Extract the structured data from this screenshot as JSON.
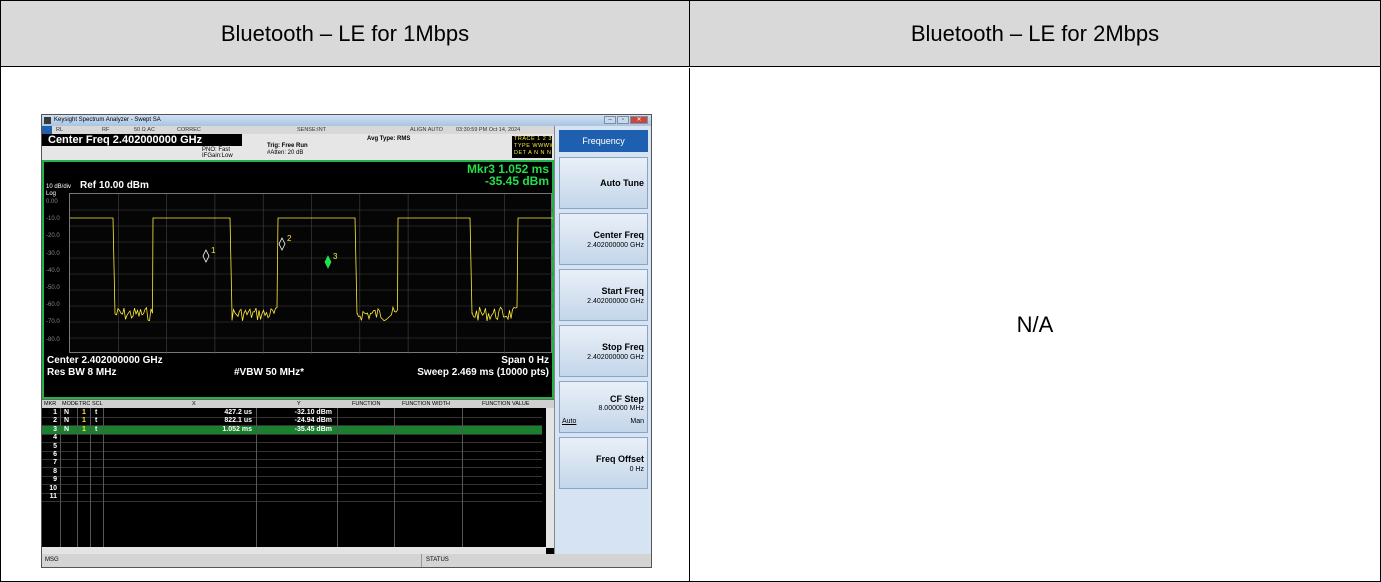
{
  "table": {
    "col1_header": "Bluetooth – LE for 1Mbps",
    "col2_header": "Bluetooth – LE for 2Mbps",
    "col2_value": "N/A"
  },
  "analyzer": {
    "window_title": "Keysight Spectrum Analyzer - Swept SA",
    "status_bar": {
      "rl": "RL",
      "rf": "RF",
      "impedance": "50 Ω AC",
      "correc": "CORREC",
      "sense": "SENSE:INT",
      "align": "ALIGN AUTO",
      "datetime": "03:30:59 PM Oct 14, 2024"
    },
    "center_freq_title": "Center Freq 2.402000000 GHz",
    "pno": "PNO: Fast",
    "ifgain": "IFGain:Low",
    "trig": "Trig: Free Run",
    "atten": "#Atten: 20 dB",
    "avg_type": "Avg Type: RMS",
    "trace_line1": "TRACE 1 2 3 4 5 6",
    "trace_line2": "TYPE WWWWWW",
    "trace_line3": "DET A N N N N N",
    "scale": "10 dB/div",
    "log_label": "Log",
    "ref_level": "Ref 10.00 dBm",
    "marker_readout_time": "Mkr3 1.052 ms",
    "marker_readout_level": "-35.45 dBm",
    "y_ticks": [
      "0.00",
      "-10.0",
      "-20.0",
      "-30.0",
      "-40.0",
      "-50.0",
      "-60.0",
      "-70.0",
      "-80.0"
    ],
    "marker_labels": [
      "1",
      "2",
      "3"
    ],
    "center_label": "Center 2.402000000 GHz",
    "span_label": "Span 0 Hz",
    "rbw_label": "Res BW 8 MHz",
    "vbw_label": "#VBW 50 MHz*",
    "sweep_label": "Sweep  2.469 ms (10000 pts)",
    "marker_table": {
      "headers": [
        "MKR",
        "MODE",
        "TRC",
        "SCL",
        "X",
        "Y",
        "FUNCTION",
        "FUNCTION WIDTH",
        "FUNCTION VALUE"
      ],
      "rows": [
        {
          "num": "1",
          "mode": "N",
          "trc": "1",
          "scl": "t",
          "x": "427.2 us",
          "y": "-32.10 dBm"
        },
        {
          "num": "2",
          "mode": "N",
          "trc": "1",
          "scl": "t",
          "x": "822.1 us",
          "y": "-24.94 dBm"
        },
        {
          "num": "3",
          "mode": "N",
          "trc": "1",
          "scl": "t",
          "x": "1.052 ms",
          "y": "-35.45 dBm"
        },
        {
          "num": "4",
          "mode": "",
          "trc": "",
          "scl": "",
          "x": "",
          "y": ""
        },
        {
          "num": "5",
          "mode": "",
          "trc": "",
          "scl": "",
          "x": "",
          "y": ""
        },
        {
          "num": "6",
          "mode": "",
          "trc": "",
          "scl": "",
          "x": "",
          "y": ""
        },
        {
          "num": "7",
          "mode": "",
          "trc": "",
          "scl": "",
          "x": "",
          "y": ""
        },
        {
          "num": "8",
          "mode": "",
          "trc": "",
          "scl": "",
          "x": "",
          "y": ""
        },
        {
          "num": "9",
          "mode": "",
          "trc": "",
          "scl": "",
          "x": "",
          "y": ""
        },
        {
          "num": "10",
          "mode": "",
          "trc": "",
          "scl": "",
          "x": "",
          "y": ""
        },
        {
          "num": "11",
          "mode": "",
          "trc": "",
          "scl": "",
          "x": "",
          "y": ""
        }
      ]
    },
    "footer": {
      "msg": "MSG",
      "status": "STATUS"
    },
    "softkeys": {
      "title": "Frequency",
      "auto_tune": "Auto Tune",
      "center_freq": "Center Freq",
      "center_freq_val": "2.402000000 GHz",
      "start_freq": "Start Freq",
      "start_freq_val": "2.402000000 GHz",
      "stop_freq": "Stop Freq",
      "stop_freq_val": "2.402000000 GHz",
      "cf_step": "CF Step",
      "cf_step_val": "8.000000 MHz",
      "cf_step_auto": "Auto",
      "cf_step_man": "Man",
      "freq_offset": "Freq Offset",
      "freq_offset_val": "0 Hz"
    },
    "colors": {
      "trace": "#ffeb3b",
      "marker_text": "#22e04c",
      "graph_border": "#22b14c",
      "softkey_title": "#1f5fb0"
    }
  }
}
